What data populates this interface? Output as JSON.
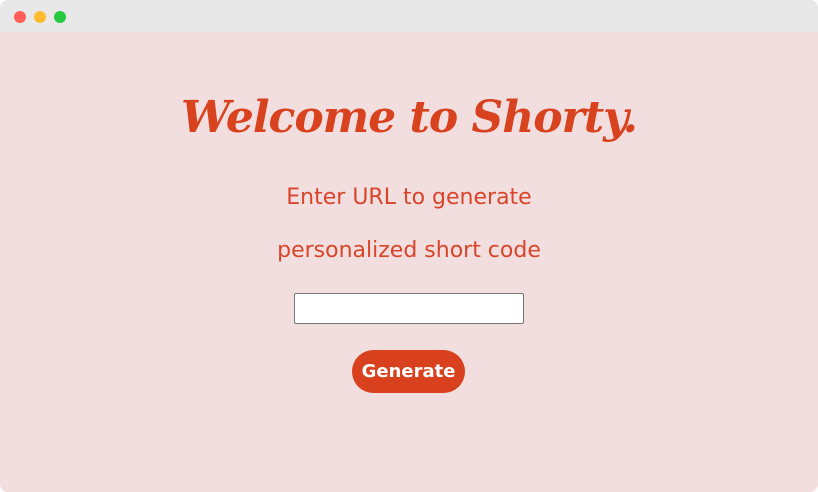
{
  "colors": {
    "background": "#f2dede",
    "accent": "#d9421f",
    "titlebar": "#e8e8e8"
  },
  "window": {
    "controls": [
      "close",
      "minimize",
      "maximize"
    ]
  },
  "main": {
    "heading": "Welcome to Shorty.",
    "subtitle_line1": "Enter URL to generate",
    "subtitle_line2": "personalized short code",
    "url_input": {
      "value": "",
      "placeholder": ""
    },
    "generate_label": "Generate"
  }
}
